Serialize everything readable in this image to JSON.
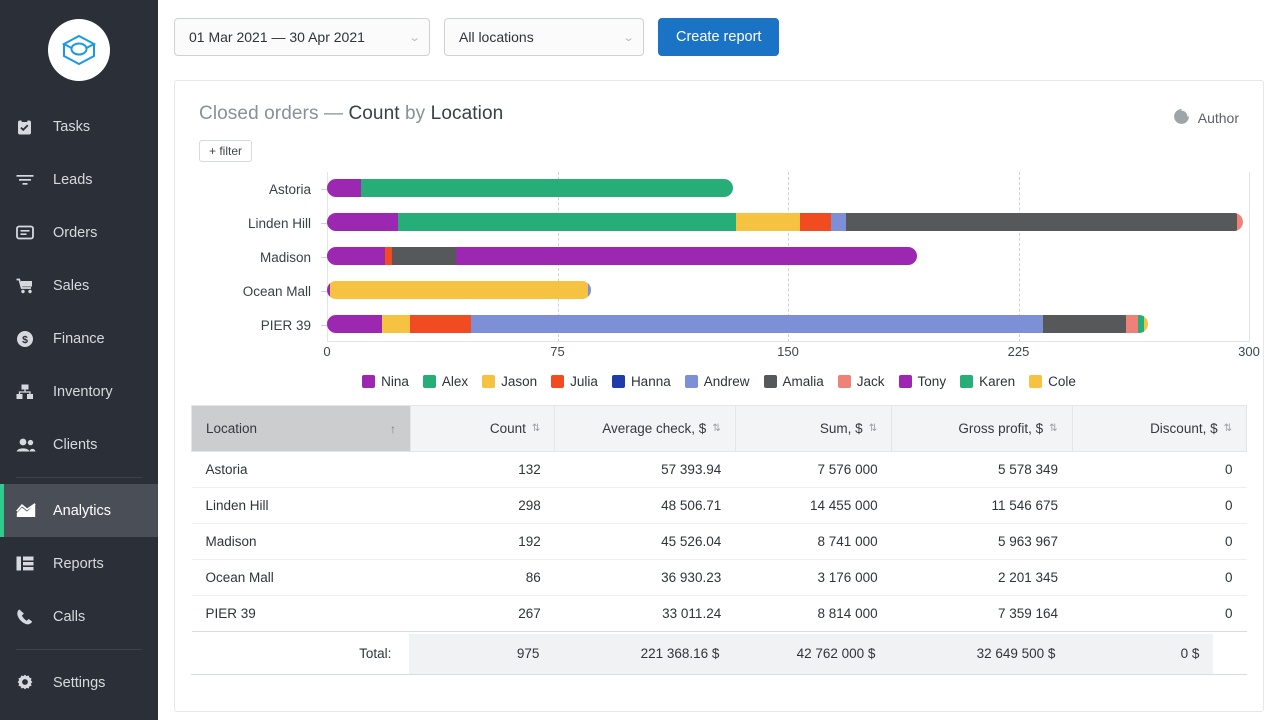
{
  "sidebar": {
    "logo_name": "cube-logo",
    "items": [
      {
        "label": "Tasks",
        "icon": "clipboard-check-icon",
        "active": false
      },
      {
        "label": "Leads",
        "icon": "funnel-icon",
        "active": false
      },
      {
        "label": "Orders",
        "icon": "inbox-icon",
        "active": false
      },
      {
        "label": "Sales",
        "icon": "shopping-cart-icon",
        "active": false
      },
      {
        "label": "Finance",
        "icon": "dollar-circle-icon",
        "active": false
      },
      {
        "label": "Inventory",
        "icon": "sitemap-icon",
        "active": false
      },
      {
        "label": "Clients",
        "icon": "users-icon",
        "active": false
      },
      {
        "label": "Analytics",
        "icon": "area-chart-icon",
        "active": true
      },
      {
        "label": "Reports",
        "icon": "table-layout-icon",
        "active": false
      },
      {
        "label": "Calls",
        "icon": "phone-icon",
        "active": false
      },
      {
        "label": "Settings",
        "icon": "gear-icon",
        "active": false
      }
    ],
    "accent_color": "#2ecc8f",
    "background_color": "#2b3038"
  },
  "toolbar": {
    "date_range": "01 Mar 2021 — 30 Apr 2021",
    "location_filter": "All locations",
    "create_report_label": "Create report",
    "primary_color": "#1a73c4"
  },
  "card": {
    "title_prefix": "Closed orders — ",
    "title_metric": "Count",
    "title_by": " by ",
    "title_dimension": "Location",
    "filter_label": "+ filter",
    "author_label": "Author",
    "author_icon": "pie-chart-icon"
  },
  "chart_data": {
    "type": "bar",
    "orientation": "horizontal",
    "stacked": true,
    "title": "Closed orders — Count by Location",
    "xlabel": "",
    "ylabel": "",
    "xlim": [
      0,
      300
    ],
    "xticks": [
      0,
      75,
      150,
      225,
      300
    ],
    "grid": true,
    "legend_position": "bottom",
    "categories": [
      "Astoria",
      "Linden Hill",
      "Madison",
      "Ocean Mall",
      "PIER 39"
    ],
    "series": [
      {
        "name": "Nina",
        "color": "#9c27b0",
        "values": [
          11,
          23,
          19,
          1,
          18
        ]
      },
      {
        "name": "Alex",
        "color": "#27ae78",
        "values": [
          121,
          110,
          0,
          0,
          0
        ]
      },
      {
        "name": "Jason",
        "color": "#f5c242",
        "values": [
          0,
          21,
          0,
          84,
          9
        ]
      },
      {
        "name": "Julia",
        "color": "#f14b22",
        "values": [
          0,
          10,
          2,
          0,
          20
        ]
      },
      {
        "name": "Hanna",
        "color": "#1f3da8",
        "values": [
          0,
          0,
          0,
          0,
          0
        ]
      },
      {
        "name": "Andrew",
        "color": "#7d8fd6",
        "values": [
          0,
          5,
          0,
          1,
          186
        ]
      },
      {
        "name": "Amalia",
        "color": "#56585a",
        "values": [
          0,
          127,
          21,
          0,
          27
        ]
      },
      {
        "name": "Jack",
        "color": "#ef8278",
        "values": [
          0,
          2,
          0,
          0,
          4
        ]
      },
      {
        "name": "Tony",
        "color": "#9c27b0",
        "values": [
          0,
          0,
          150,
          0,
          0
        ]
      },
      {
        "name": "Karen",
        "color": "#27ae78",
        "values": [
          0,
          0,
          0,
          0,
          2
        ]
      },
      {
        "name": "Cole",
        "color": "#f5c242",
        "values": [
          0,
          0,
          0,
          0,
          1
        ]
      }
    ],
    "totals": [
      132,
      298,
      192,
      86,
      267
    ]
  },
  "table": {
    "columns": [
      {
        "label": "Location",
        "sort": "asc",
        "align": "left"
      },
      {
        "label": "Count",
        "sort": "none",
        "align": "right"
      },
      {
        "label": "Average check, $",
        "sort": "none",
        "align": "right"
      },
      {
        "label": "Sum, $",
        "sort": "none",
        "align": "right"
      },
      {
        "label": "Gross profit, $",
        "sort": "none",
        "align": "right"
      },
      {
        "label": "Discount, $",
        "sort": "none",
        "align": "right"
      }
    ],
    "rows": [
      {
        "location": "Astoria",
        "count": "132",
        "avg": "57 393.94",
        "sum": "7 576 000",
        "gross": "5 578 349",
        "discount": "0"
      },
      {
        "location": "Linden Hill",
        "count": "298",
        "avg": "48 506.71",
        "sum": "14 455 000",
        "gross": "11 546 675",
        "discount": "0"
      },
      {
        "location": "Madison",
        "count": "192",
        "avg": "45 526.04",
        "sum": "8 741 000",
        "gross": "5 963 967",
        "discount": "0"
      },
      {
        "location": "Ocean Mall",
        "count": "86",
        "avg": "36 930.23",
        "sum": "3 176 000",
        "gross": "2 201 345",
        "discount": "0"
      },
      {
        "location": "PIER 39",
        "count": "267",
        "avg": "33 011.24",
        "sum": "8 814 000",
        "gross": "7 359 164",
        "discount": "0"
      }
    ],
    "total": {
      "label": "Total:",
      "count": "975",
      "avg": "221 368.16 $",
      "sum": "42 762 000 $",
      "gross": "32 649 500 $",
      "discount": "0 $"
    }
  }
}
